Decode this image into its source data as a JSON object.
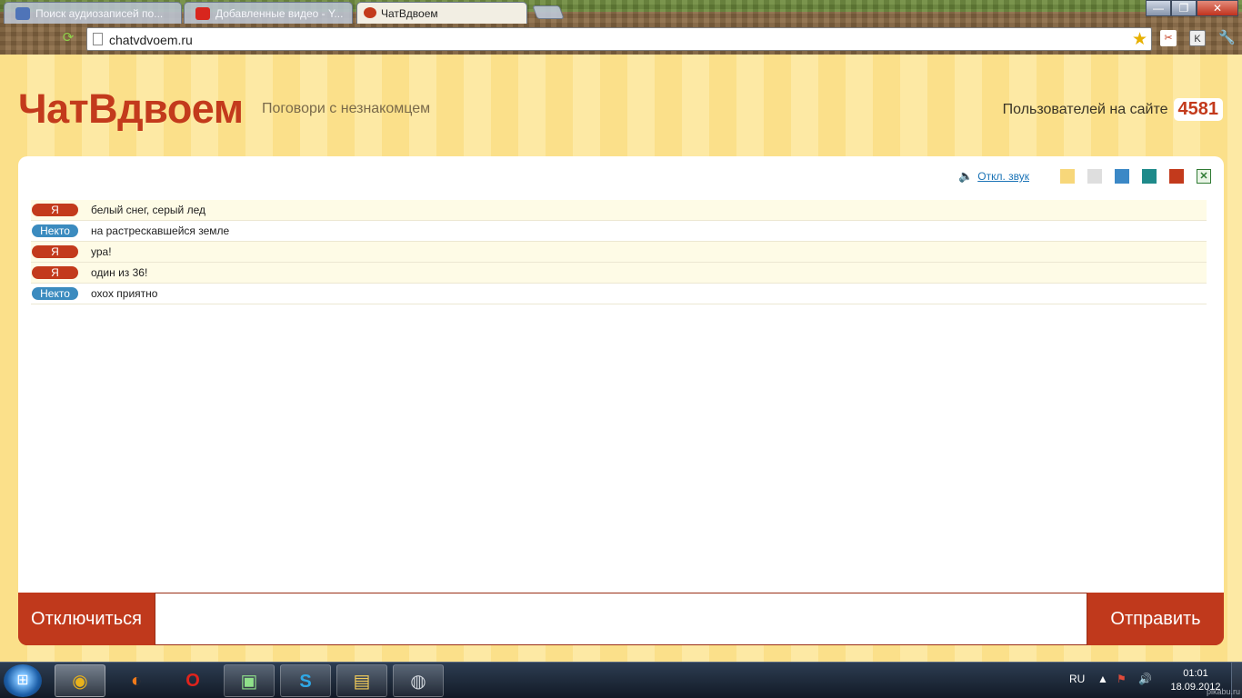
{
  "browser": {
    "tabs": [
      {
        "title": "Поиск аудиозаписей по...",
        "active": false
      },
      {
        "title": "Добавленные видео - Y...",
        "active": false
      },
      {
        "title": "ЧатВдвоем",
        "active": true
      }
    ],
    "window_buttons": {
      "minimize": "—",
      "maximize": "❐",
      "close": "✕"
    },
    "reload_icon": "reload-icon",
    "address": "chatvdvoem.ru",
    "extensions": [
      "bookmark-star-icon",
      "cut-icon",
      "k-extension-icon",
      "wrench-icon"
    ]
  },
  "site": {
    "logo": "ЧатВдвоем",
    "tagline": "Поговори с незнакомцем",
    "users_label": "Пользователей на сайте",
    "users_count": "4581"
  },
  "chat": {
    "mute_label": "Откл. звук",
    "theme_colors": [
      "#f7d77a",
      "#dedede",
      "#3b88c6",
      "#1e8a8a",
      "#c33a1c"
    ],
    "colors": {
      "me": "#c33a1c",
      "stranger": "#3b8bbf"
    },
    "messages": [
      {
        "author": "Я",
        "role": "me",
        "text": "белый снег, серый лед"
      },
      {
        "author": "Некто",
        "role": "other",
        "text": "на растрескавшейся земле"
      },
      {
        "author": "Я",
        "role": "me",
        "text": "ура!"
      },
      {
        "author": "Я",
        "role": "me",
        "text": "один из 36!"
      },
      {
        "author": "Некто",
        "role": "other",
        "text": "охох приятно"
      }
    ],
    "disconnect_label": "Отключиться",
    "send_label": "Отправить",
    "input_value": ""
  },
  "taskbar": {
    "apps": [
      "chrome-icon",
      "firefox-icon",
      "opera-icon",
      "task-manager-icon",
      "skype-icon",
      "explorer-icon",
      "speaker-app-icon"
    ],
    "lang": "RU",
    "time": "01:01",
    "date": "18.09.2012",
    "watermark": "pikabu.ru"
  }
}
